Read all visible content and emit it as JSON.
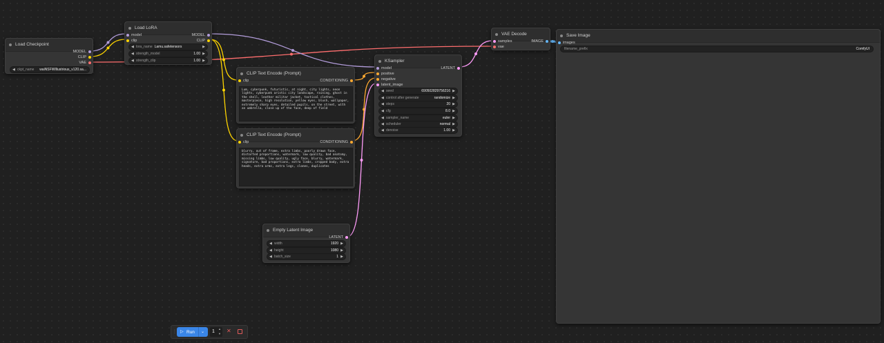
{
  "colors": {
    "model": "#b39ddb",
    "clip": "#ffd500",
    "vae": "#ff6e6e",
    "conditioning": "#ffa931",
    "latent": "#ff9cf9",
    "image": "#64b5f6",
    "run_button": "#3a86e8"
  },
  "load_checkpoint": {
    "title": "Load Checkpoint",
    "outputs": [
      "MODEL",
      "CLIP",
      "VAE"
    ],
    "ckpt_label": "ckpt_name",
    "ckpt_value": "waiNSFWIllustrious_v120.sa..."
  },
  "load_lora": {
    "title": "Load LoRA",
    "inputs": [
      "model",
      "clip"
    ],
    "outputs": [
      "MODEL",
      "CLIP"
    ],
    "lora_label": "lora_name",
    "lora_value": "Lamu.safetensors",
    "strength_model_label": "strength_model",
    "strength_model_value": "1.00",
    "strength_clip_label": "strength_clip",
    "strength_clip_value": "1.00"
  },
  "clip_pos": {
    "title": "CLIP Text Encode (Prompt)",
    "input": "clip",
    "output": "CONDITIONING",
    "text": "Lum, cyberpunk, futuristic, at night, city lights, neon lights, cyberpunk aristic city landscape, raining, ghost in the shell, leather militar jacket, tactical clothes, masterpiece, high resolution, yellow eyes, blush, wallpaper, extremely sharp eyes, detailed pupils, on the street, with an umbrella, close up of the face, deep of field"
  },
  "clip_neg": {
    "title": "CLIP Text Encode (Prompt)",
    "input": "clip",
    "output": "CONDITIONING",
    "text": "blurry, out of frame, extra limbs, poorly drawn face, distorted proportions, watermark, low quality, bad anatomy, missing limbs, low quality, ugly face, blurry, watermark, signature, bad proportions, extra limbs, cropped body, extra heads, extra arms, extra legs, clones, duplicates"
  },
  "empty_latent": {
    "title": "Empty Latent Image",
    "output": "LATENT",
    "width_label": "width",
    "width_value": "1920",
    "height_label": "height",
    "height_value": "1080",
    "batch_label": "batch_size",
    "batch_value": "1"
  },
  "ksampler": {
    "title": "KSampler",
    "inputs": [
      "model",
      "positive",
      "negative",
      "latent_image"
    ],
    "output": "LATENT",
    "seed_label": "seed",
    "seed_value": "690502829756216",
    "control_label": "control after generate",
    "control_value": "randomize",
    "steps_label": "steps",
    "steps_value": "20",
    "cfg_label": "cfg",
    "cfg_value": "8.0",
    "sampler_label": "sampler_name",
    "sampler_value": "euler",
    "scheduler_label": "scheduler",
    "scheduler_value": "normal",
    "denoise_label": "denoise",
    "denoise_value": "1.00"
  },
  "vae_decode": {
    "title": "VAE Decode",
    "inputs": [
      "samples",
      "vae"
    ],
    "output": "IMAGE"
  },
  "save_image": {
    "title": "Save Image",
    "input": "images",
    "prefix_label": "filename_prefix",
    "prefix_value": "ComfyUI"
  },
  "toolbar": {
    "grip": "⋮⋮",
    "run_label": "Run",
    "play_glyph": "▷",
    "chevron": "⌄",
    "batch_count": "1",
    "cancel_glyph": "✕"
  }
}
